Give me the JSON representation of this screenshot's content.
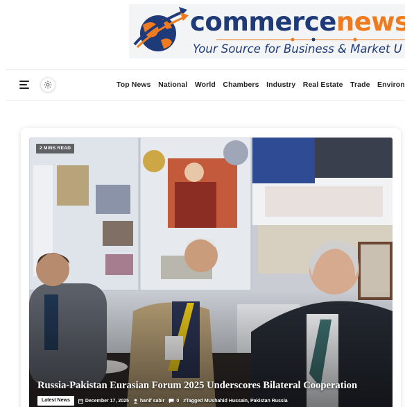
{
  "logo": {
    "word_part1": "commerce",
    "word_part2": "news",
    "tagline": "Your Source for Business & Market U",
    "colors": {
      "navy": "#1f3a78",
      "orange": "#f07b1f"
    }
  },
  "nav": {
    "menu_icon": "hamburger-icon",
    "theme_icon": "sun-icon",
    "items": [
      "Top News",
      "National",
      "World",
      "Chambers",
      "Industry",
      "Real Estate",
      "Trade",
      "Environme"
    ]
  },
  "featured": {
    "read_time": "2 MINS READ",
    "title": "Russia-Pakistan Eurasian Forum 2025 Underscores Bilateral Cooperation",
    "category": "Latest News",
    "date": "December 17, 2025",
    "author": "hanif sabir",
    "comments": "0",
    "tags_label": "Tagged",
    "tags": "MUshahid Hussain, Pakistan Russia"
  }
}
